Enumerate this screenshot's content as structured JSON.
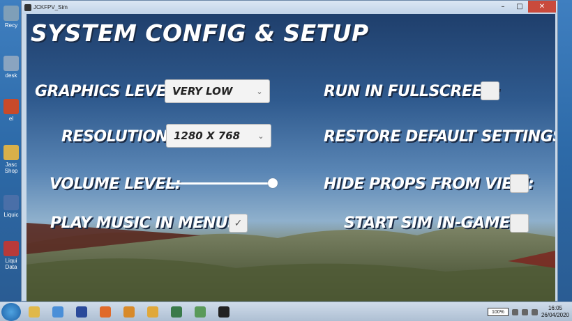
{
  "window": {
    "title": "JCKFPV_Sim",
    "minimize": "–",
    "maximize": "□",
    "close": "✕"
  },
  "config": {
    "title": "SYSTEM CONFIG & SETUP",
    "graphics_label": "GRAPHICS LEVEL:",
    "graphics_value": "VERY LOW",
    "resolution_label": "RESOLUTION:",
    "resolution_value": "1280 X 768",
    "volume_label": "VOLUME LEVEL:",
    "volume_level": 1.0,
    "music_label": "PLAY MUSIC IN MENUS:",
    "music_checked": true,
    "fullscreen_label": "RUN IN FULLSCREEN:",
    "fullscreen_checked": false,
    "restore_label": "RESTORE DEFAULT SETTINGS",
    "hideprops_label": "HIDE PROPS FROM VIEW:",
    "hideprops_checked": false,
    "startsim_label": "START SIM IN-GAME:",
    "startsim_checked": false,
    "check_glyph": "✓",
    "chevron_glyph": "⌄"
  },
  "desktop": {
    "icons": [
      {
        "label": "Recy",
        "icon": "recycle-bin-icon",
        "color": "#7f9fb8"
      },
      {
        "label": "desk",
        "icon": "desktop-icon",
        "color": "#8aa4c0"
      },
      {
        "label": "el",
        "icon": "app-icon",
        "color": "#c84a2a"
      },
      {
        "label": "Jasc Shop",
        "icon": "paint-shop-icon",
        "color": "#d8b04a"
      },
      {
        "label": "Liquic",
        "icon": "liquid-icon",
        "color": "#4a6fa8"
      },
      {
        "label": "Liqui Data",
        "icon": "liquid-data-icon",
        "color": "#b83a3a"
      }
    ]
  },
  "taskbar": {
    "apps": [
      {
        "icon": "folder-icon",
        "color": "#e0b84a"
      },
      {
        "icon": "chrome-icon",
        "color": "#4a8fd8"
      },
      {
        "icon": "pg-icon",
        "color": "#2a4a9a"
      },
      {
        "icon": "firefox-icon",
        "color": "#e06a2a"
      },
      {
        "icon": "drone-icon",
        "color": "#d88a2a"
      },
      {
        "icon": "paint-icon",
        "color": "#e0a83a"
      },
      {
        "icon": "monitor-icon",
        "color": "#3a7a4a"
      },
      {
        "icon": "photos-icon",
        "color": "#5a9a5a"
      },
      {
        "icon": "game-icon",
        "color": "#222222"
      }
    ],
    "battery": "100%",
    "time": "16:05",
    "date": "26/04/2020"
  }
}
